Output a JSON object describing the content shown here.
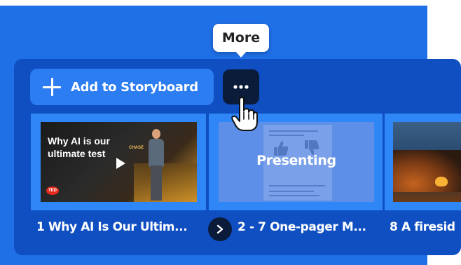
{
  "tooltip": {
    "text": "More"
  },
  "toolbar": {
    "add_label": "Add to Storyboard",
    "add_icon": "plus-icon",
    "more_icon": "more-horizontal-icon"
  },
  "cursor": {
    "icon": "hand-pointer-icon"
  },
  "scenes": [
    {
      "caption": "1 Why AI Is Our Ultim...",
      "thumb_title": "Why AI is our ultimate test",
      "thumb_brand": "CHASE",
      "thumb_logo": "TED",
      "overlay_icon": "play-icon"
    },
    {
      "caption": "2 - 7 One-pager M...",
      "overlay_text": "Presenting"
    },
    {
      "caption": "8 A firesid"
    }
  ],
  "nav": {
    "next_icon": "chevron-right-icon"
  },
  "colors": {
    "background_blue": "#1f6fe6",
    "panel_blue": "#0f4fc2",
    "button_blue": "#2d7df2",
    "dark_button": "#0b1c3a",
    "selected_thumb": "#2f86f7"
  }
}
